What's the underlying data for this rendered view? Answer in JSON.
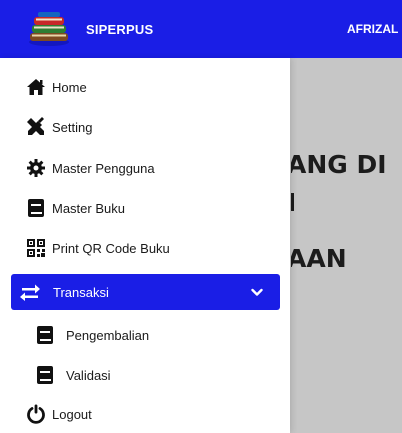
{
  "header": {
    "app_name": "SIPERPUS",
    "user_name": "AFRIZAL"
  },
  "hero": {
    "lines": [
      "ANG DI",
      "I",
      "AAN"
    ]
  },
  "sidebar": {
    "items": [
      {
        "label": "Home",
        "icon": "home-icon"
      },
      {
        "label": "Setting",
        "icon": "tools-icon"
      },
      {
        "label": "Master Pengguna",
        "icon": "gear-icon"
      },
      {
        "label": "Master Buku",
        "icon": "book-icon"
      },
      {
        "label": "Print QR Code Buku",
        "icon": "qr-code-icon"
      },
      {
        "label": "Transaksi",
        "icon": "exchange-icon",
        "active": true,
        "expanded": true
      },
      {
        "label": "Pengembalian",
        "icon": "book-icon",
        "sub": true
      },
      {
        "label": "Validasi",
        "icon": "book-icon",
        "sub": true
      },
      {
        "label": "Logout",
        "icon": "power-icon"
      }
    ]
  },
  "colors": {
    "primary": "#1a1ee6",
    "overlay": "#c6c6c6",
    "text": "#1a1a1a"
  }
}
